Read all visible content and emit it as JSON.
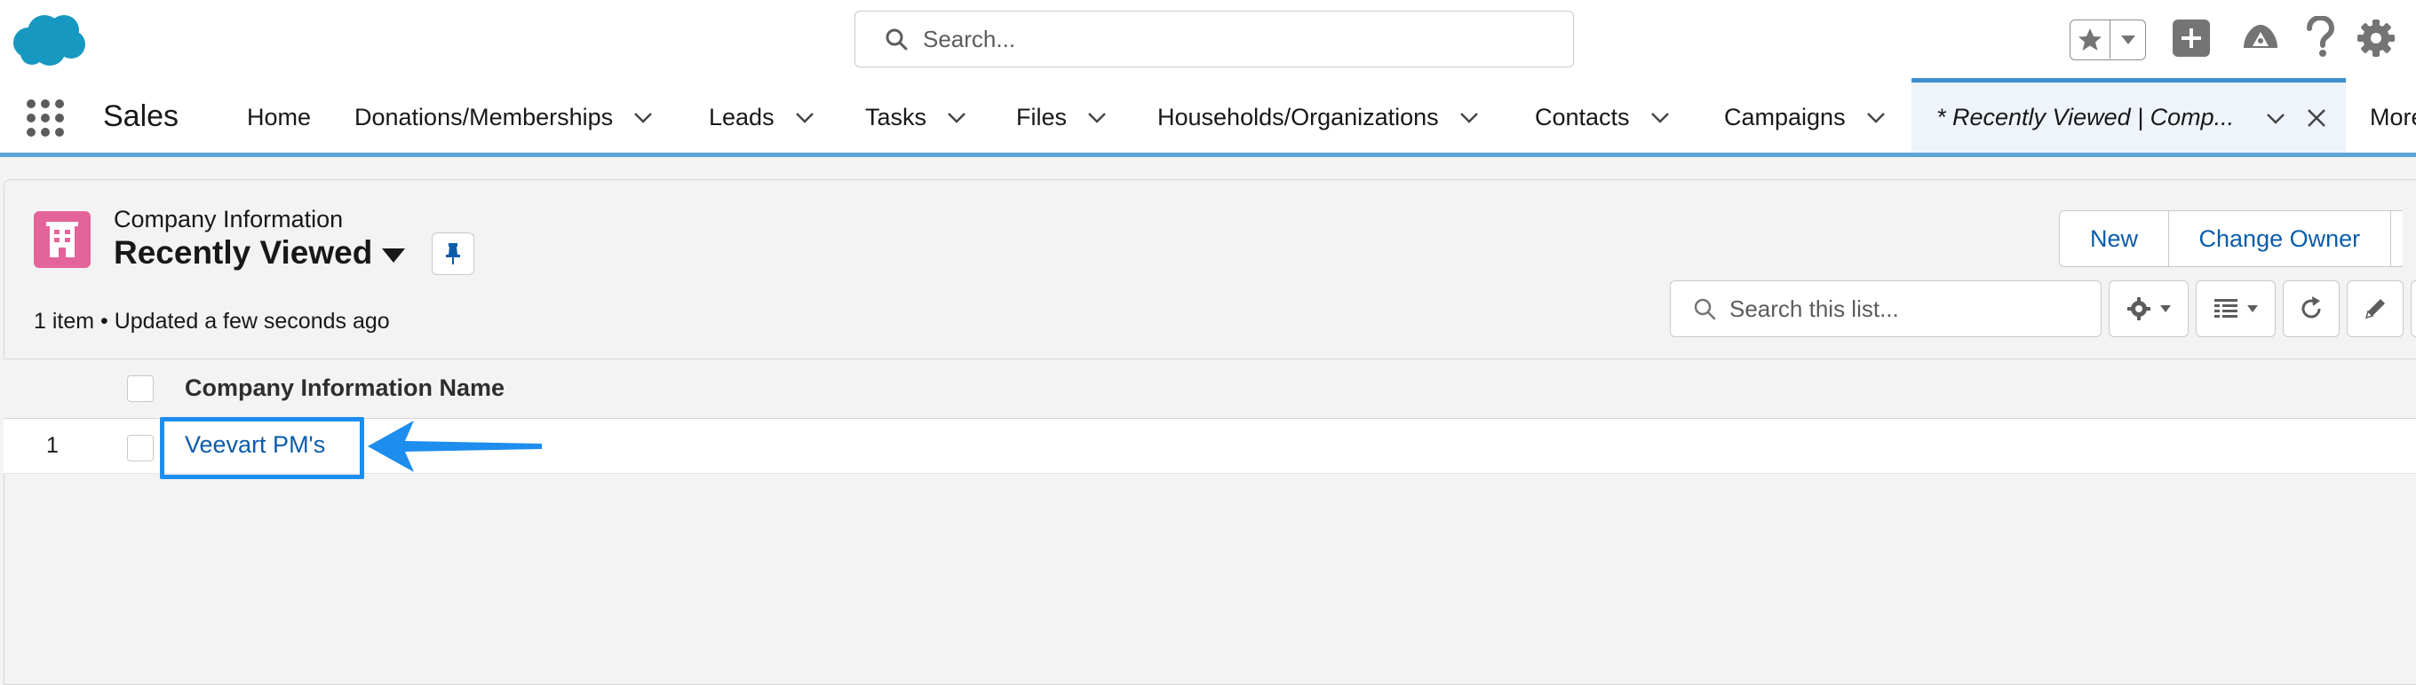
{
  "global_header": {
    "search_placeholder": "Search...",
    "icons": [
      "salesforce-cloud-logo",
      "favorites-star-icon",
      "favorites-dropdown-icon",
      "global-actions-plus-icon",
      "trailhead-icon",
      "help-icon",
      "setup-gear-icon"
    ]
  },
  "nav": {
    "app_name": "Sales",
    "items": [
      {
        "label": "Home",
        "has_menu": false
      },
      {
        "label": "Donations/Memberships",
        "has_menu": true
      },
      {
        "label": "Leads",
        "has_menu": true
      },
      {
        "label": "Tasks",
        "has_menu": true
      },
      {
        "label": "Files",
        "has_menu": true
      },
      {
        "label": "Households/Organizations",
        "has_menu": true
      },
      {
        "label": "Contacts",
        "has_menu": true
      },
      {
        "label": "Campaigns",
        "has_menu": true
      }
    ],
    "active_tab": {
      "label": "* Recently Viewed | Comp..."
    },
    "more_label": "More"
  },
  "list_view": {
    "object_type": "Company Information",
    "title": "Recently Viewed",
    "meta": "1 item • Updated a few seconds ago",
    "buttons": {
      "new": "New",
      "change_owner": "Change Owner"
    },
    "search_placeholder": "Search this list...",
    "columns": [
      "Company Information Name"
    ],
    "rows": [
      {
        "num": "1",
        "name": "Veevart PM's"
      }
    ]
  },
  "colors": {
    "brand_blue": "#0b5cab",
    "object_icon": "#e3649a",
    "highlight": "#1d8dee",
    "nav_accent": "#5ea4d6"
  }
}
